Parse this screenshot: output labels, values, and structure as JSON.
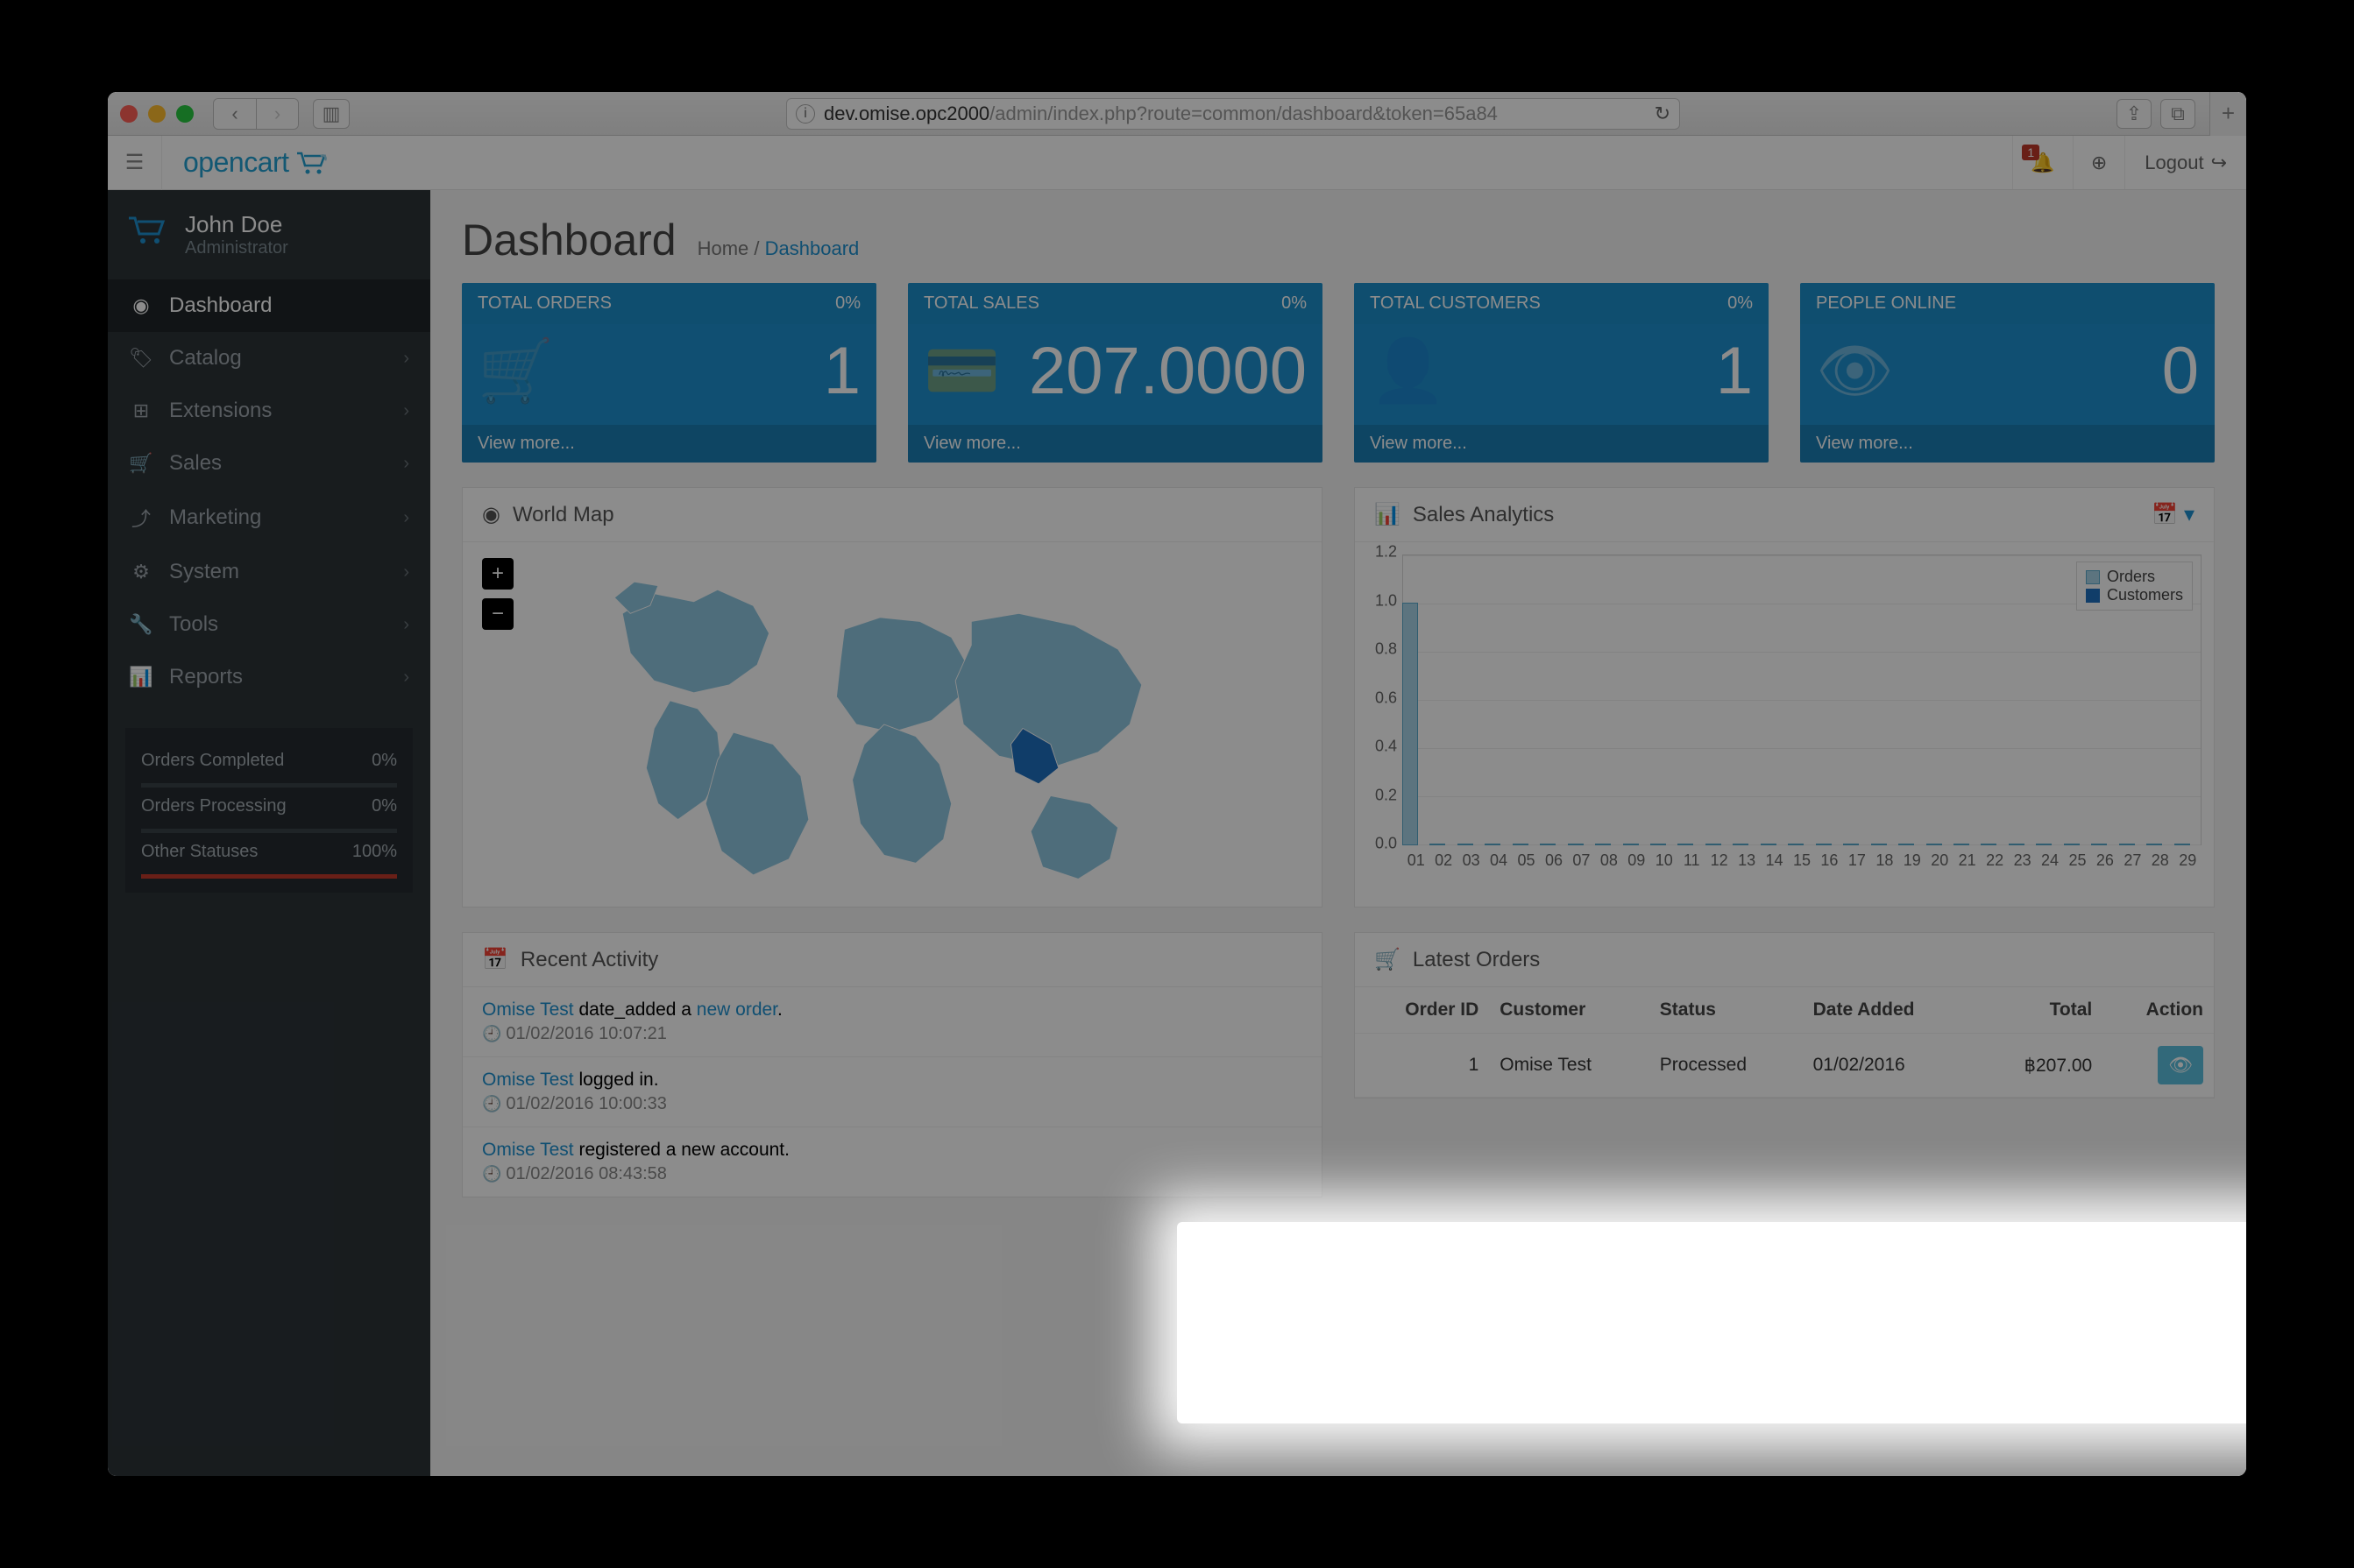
{
  "browser": {
    "url_host": "dev.omise.opc2000",
    "url_path": "/admin/index.php?route=common/dashboard&token=65a84"
  },
  "topbar": {
    "logo": "opencart",
    "notification_count": "1",
    "logout_label": "Logout"
  },
  "user": {
    "name": "John Doe",
    "role": "Administrator"
  },
  "sidebar": {
    "items": [
      {
        "label": "Dashboard",
        "icon": "⌾",
        "active": true
      },
      {
        "label": "Catalog",
        "icon": "🏷"
      },
      {
        "label": "Extensions",
        "icon": "✚"
      },
      {
        "label": "Sales",
        "icon": "🛒"
      },
      {
        "label": "Marketing",
        "icon": "↗"
      },
      {
        "label": "System",
        "icon": "⚙"
      },
      {
        "label": "Tools",
        "icon": "🔧"
      },
      {
        "label": "Reports",
        "icon": "📊"
      }
    ],
    "stats": [
      {
        "label": "Orders Completed",
        "value": "0%"
      },
      {
        "label": "Orders Processing",
        "value": "0%"
      },
      {
        "label": "Other Statuses",
        "value": "100%"
      }
    ]
  },
  "page": {
    "title": "Dashboard",
    "breadcrumb_home": "Home",
    "breadcrumb_current": "Dashboard"
  },
  "tiles": [
    {
      "title": "TOTAL ORDERS",
      "pct": "0%",
      "value": "1",
      "more": "View more..."
    },
    {
      "title": "TOTAL SALES",
      "pct": "0%",
      "value": "207.0000",
      "more": "View more..."
    },
    {
      "title": "TOTAL CUSTOMERS",
      "pct": "0%",
      "value": "1",
      "more": "View more..."
    },
    {
      "title": "PEOPLE ONLINE",
      "pct": "",
      "value": "0",
      "more": "View more..."
    }
  ],
  "map_panel": {
    "title": "World Map"
  },
  "analytics_panel": {
    "title": "Sales Analytics"
  },
  "chart_data": {
    "type": "bar",
    "categories": [
      "01",
      "02",
      "03",
      "04",
      "05",
      "06",
      "07",
      "08",
      "09",
      "10",
      "11",
      "12",
      "13",
      "14",
      "15",
      "16",
      "17",
      "18",
      "19",
      "20",
      "21",
      "22",
      "23",
      "24",
      "25",
      "26",
      "27",
      "28",
      "29"
    ],
    "series": [
      {
        "name": "Orders",
        "color": "#a8d4e8",
        "values": [
          1,
          0,
          0,
          0,
          0,
          0,
          0,
          0,
          0,
          0,
          0,
          0,
          0,
          0,
          0,
          0,
          0,
          0,
          0,
          0,
          0,
          0,
          0,
          0,
          0,
          0,
          0,
          0,
          0
        ]
      },
      {
        "name": "Customers",
        "color": "#1e6fbf",
        "values": [
          0,
          0,
          0,
          0,
          0,
          0,
          0,
          0,
          0,
          0,
          0,
          0,
          0,
          0,
          0,
          0,
          0,
          0,
          0,
          0,
          0,
          0,
          0,
          0,
          0,
          0,
          0,
          0,
          0
        ]
      }
    ],
    "yticks": [
      "0.0",
      "0.2",
      "0.4",
      "0.6",
      "0.8",
      "1.0",
      "1.2"
    ],
    "ylim": [
      0,
      1.2
    ]
  },
  "activity": {
    "title": "Recent Activity",
    "items": [
      {
        "user": "Omise Test",
        "text_mid": " date_added a ",
        "link": "new order",
        "suffix": ".",
        "time": "01/02/2016 10:07:21"
      },
      {
        "user": "Omise Test",
        "text_mid": " logged in.",
        "link": "",
        "suffix": "",
        "time": "01/02/2016 10:00:33"
      },
      {
        "user": "Omise Test",
        "text_mid": " registered a new account.",
        "link": "",
        "suffix": "",
        "time": "01/02/2016 08:43:58"
      }
    ]
  },
  "orders": {
    "title": "Latest Orders",
    "headers": {
      "id": "Order ID",
      "customer": "Customer",
      "status": "Status",
      "date": "Date Added",
      "total": "Total",
      "action": "Action"
    },
    "rows": [
      {
        "id": "1",
        "customer": "Omise Test",
        "status": "Processed",
        "date": "01/02/2016",
        "total": "฿207.00"
      }
    ]
  }
}
